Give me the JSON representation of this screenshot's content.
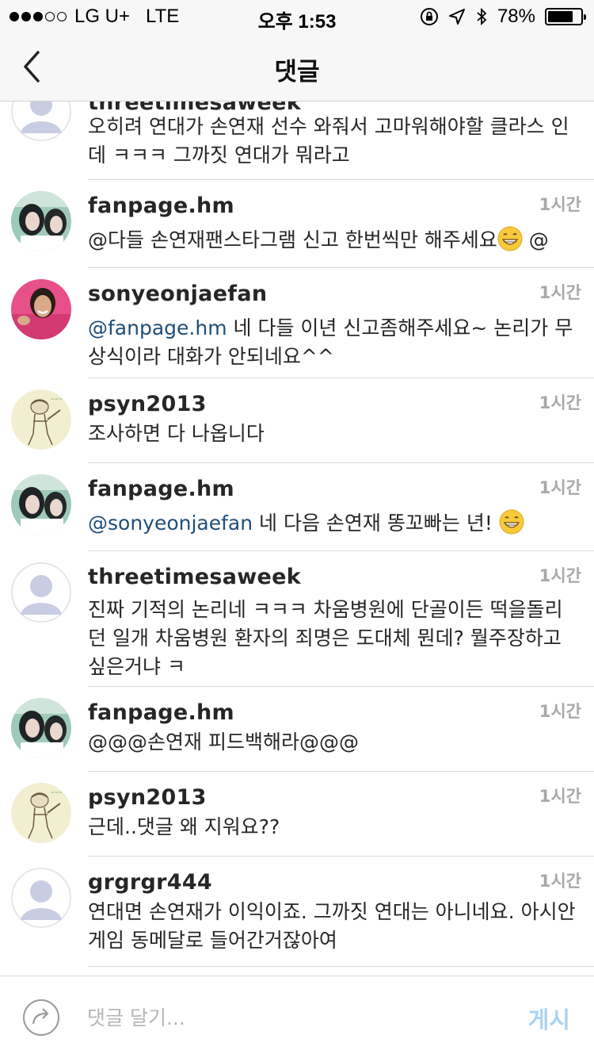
{
  "status_bar": {
    "carrier": "LG U+",
    "network": "LTE",
    "time": "오후 1:53",
    "battery": "78%",
    "battery_level": 0.78
  },
  "nav": {
    "title": "댓글"
  },
  "comments": [
    {
      "username": "threetimesaweek",
      "time": "",
      "avatar": "default",
      "text": "오히려 연대가 손연재 선수 와줘서 고마워해야할 클라스 인데 ㅋㅋㅋ 그까짓 연대가 뭐라고"
    },
    {
      "username": "fanpage.hm",
      "time": "1시간",
      "avatar": "photo-girl",
      "text": "@다들 손연재팬스타그램 신고 한번씩만 해주세요",
      "text_after": " @"
    },
    {
      "username": "sonyeonjaefan",
      "time": "1시간",
      "avatar": "photo-pink",
      "mention": "@fanpage.hm",
      "text": " 네 다들 이년 신고좀해주세요~ 논리가 무상식이라 대화가 안되네요^^"
    },
    {
      "username": "psyn2013",
      "time": "1시간",
      "avatar": "drawing",
      "text": "조사하면 다 나옵니다"
    },
    {
      "username": "fanpage.hm",
      "time": "1시간",
      "avatar": "photo-girl",
      "mention": "@sonyeonjaefan",
      "text": " 네 다음 손연재 똥꼬빠는 년! "
    },
    {
      "username": "threetimesaweek",
      "time": "1시간",
      "avatar": "default",
      "text": "진짜 기적의 논리네 ㅋㅋㅋ 차움병원에 단골이든 떡을돌리던 일개 차움병원 환자의 죄명은 도대체 뭔데? 뭘주장하고 싶은거냐 ㅋ"
    },
    {
      "username": "fanpage.hm",
      "time": "1시간",
      "avatar": "photo-girl",
      "text": "@@@손연재 피드백해라@@@"
    },
    {
      "username": "psyn2013",
      "time": "1시간",
      "avatar": "drawing",
      "text": "근데..댓글 왜 지워요??"
    },
    {
      "username": "grgrgr444",
      "time": "1시간",
      "avatar": "default",
      "text": "연대면 손연재가 이익이죠. 그까짓 연대는 아니네요. 아시안게임 동메달로 들어간거잖아여"
    }
  ],
  "input_bar": {
    "placeholder": "댓글 달기...",
    "post_label": "게시"
  },
  "colors": {
    "link": "#1f4e79",
    "post_button": "#a8d4f5",
    "time": "#a8a8a8"
  }
}
